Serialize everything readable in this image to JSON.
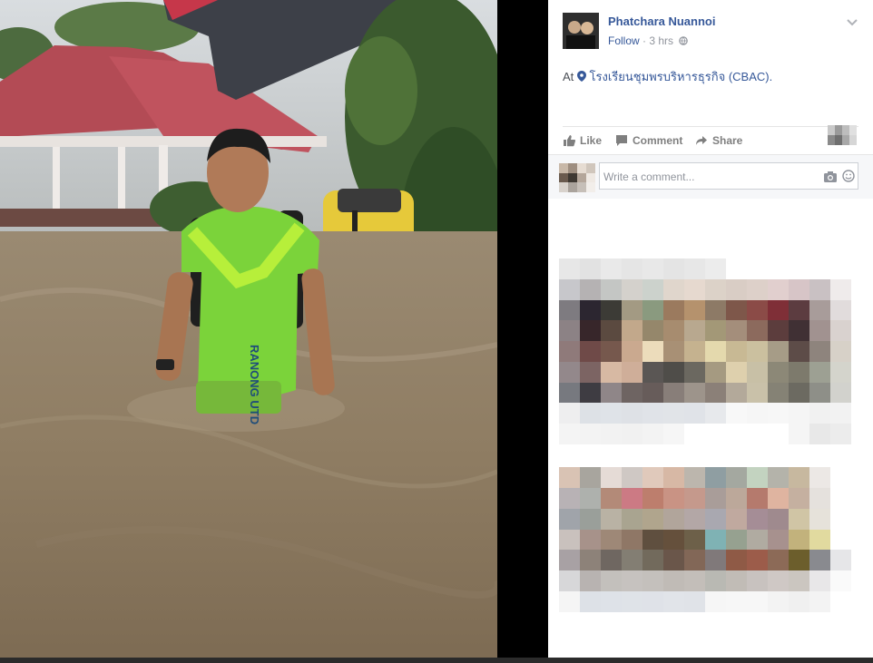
{
  "post": {
    "author": "Phatchara Nuannoi",
    "follow_label": "Follow",
    "time": "3 hrs",
    "location_prefix": "At",
    "location_name": "โรงเรียนชุมพรบริหารธุรกิจ (CBAC)."
  },
  "actions": {
    "like": "Like",
    "comment": "Comment",
    "share": "Share"
  },
  "comment_box": {
    "placeholder": "Write a comment..."
  },
  "photo": {
    "jersey_text": "RANONG UTD",
    "description_icon": "flood-photo"
  },
  "colors": {
    "link": "#365899",
    "meta": "#90949c",
    "action_text": "#7f7f7f"
  }
}
